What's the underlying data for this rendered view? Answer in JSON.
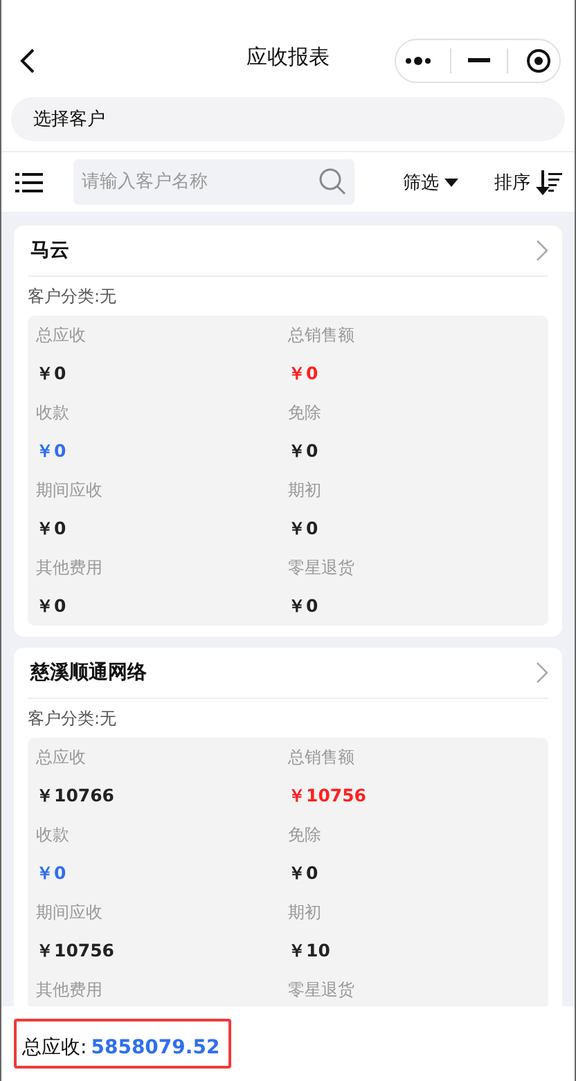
{
  "nav": {
    "title": "应收报表"
  },
  "customer_picker": {
    "label": "选择客户"
  },
  "toolbar": {
    "search_placeholder": "请输入客户名称",
    "filter": "筛选",
    "sort": "排序"
  },
  "customers": [
    {
      "name": "马云",
      "category": "客户分类:无",
      "stats": [
        {
          "label": "总应收",
          "value": "￥0",
          "color": "#222222"
        },
        {
          "label": "总销售额",
          "value": "￥0",
          "color": "#ff2020"
        },
        {
          "label": "收款",
          "value": "￥0",
          "color": "#2f6fec"
        },
        {
          "label": "免除",
          "value": "￥0",
          "color": "#222222"
        },
        {
          "label": "期间应收",
          "value": "￥0",
          "color": "#222222"
        },
        {
          "label": "期初",
          "value": "￥0",
          "color": "#222222"
        },
        {
          "label": "其他费用",
          "value": "￥0",
          "color": "#222222"
        },
        {
          "label": "零星退货",
          "value": "￥0",
          "color": "#222222"
        }
      ]
    },
    {
      "name": "慈溪顺通网络",
      "category": "客户分类:无",
      "stats": [
        {
          "label": "总应收",
          "value": "￥10766",
          "color": "#222222"
        },
        {
          "label": "总销售额",
          "value": "￥10756",
          "color": "#ff2020"
        },
        {
          "label": "收款",
          "value": "￥0",
          "color": "#2f6fec"
        },
        {
          "label": "免除",
          "value": "￥0",
          "color": "#222222"
        },
        {
          "label": "期间应收",
          "value": "￥10756",
          "color": "#222222"
        },
        {
          "label": "期初",
          "value": "￥10",
          "color": "#222222"
        },
        {
          "label": "其他费用"
        },
        {
          "label": "零星退货"
        }
      ]
    }
  ],
  "footer": {
    "label": "总应收:",
    "value": "5858079.52"
  }
}
